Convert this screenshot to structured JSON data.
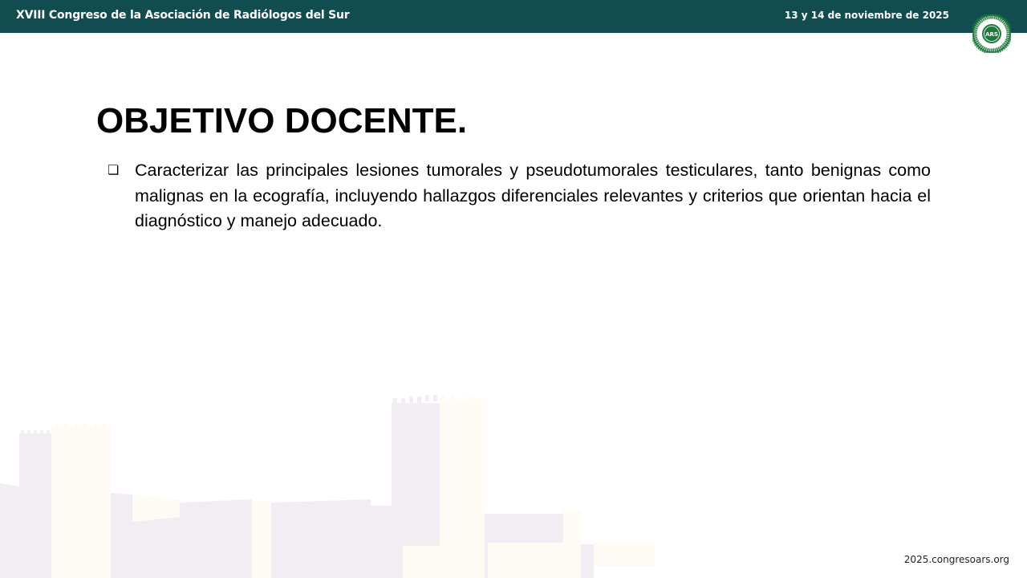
{
  "header": {
    "title": "XVIII Congreso de la Asociación de Radiólogos del Sur",
    "date": "13 y 14 de noviembre de 2025"
  },
  "logo": {
    "center": "ARS",
    "ring_top": "ASOCIACIÓN RADIÓLOGOS",
    "ring_bottom": "SUR",
    "colors": {
      "ring": "#1d7a3c",
      "center": "#1d7a3c"
    }
  },
  "slide": {
    "title": "OBJETIVO DOCENTE.",
    "bullets": [
      {
        "icon": "checkbox-bullet-icon",
        "text": "Caracterizar las principales lesiones tumorales y pseudotumorales testiculares, tanto benignas como malignas en la ecografía, incluyendo hallazgos diferenciales relevantes y criterios que orientan hacia el diagnóstico y manejo adecuado."
      }
    ]
  },
  "footer": {
    "url": "2025.congresoars.org"
  },
  "colors": {
    "header_bg": "#114c51",
    "skyline_purple": "#f2edf2",
    "skyline_cream": "#fdfbf3"
  }
}
